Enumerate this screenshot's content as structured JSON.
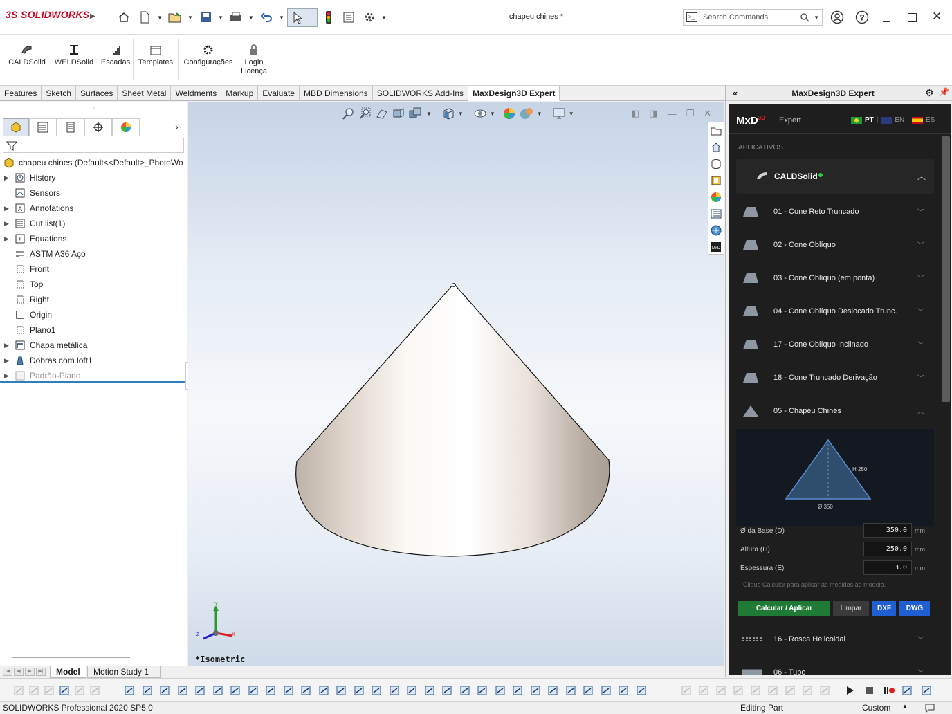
{
  "app": {
    "brand_prefix": "3S",
    "brand": "SOLIDWORKS",
    "document_title": "chapeu chines *"
  },
  "search": {
    "placeholder": "Search Commands"
  },
  "commands": [
    {
      "label": "CALDSolid"
    },
    {
      "label": "WELDSolid"
    },
    {
      "label": "Escadas"
    },
    {
      "label": "Templates"
    },
    {
      "label": "Configurações"
    },
    {
      "label": "Login\nLicença"
    }
  ],
  "tabs": [
    "Features",
    "Sketch",
    "Surfaces",
    "Sheet Metal",
    "Weldments",
    "Markup",
    "Evaluate",
    "MBD Dimensions",
    "SOLIDWORKS Add-Ins",
    "MaxDesign3D Expert"
  ],
  "active_tab": "MaxDesign3D Expert",
  "feature_tree": {
    "root": "chapeu chines  (Default<<Default>_PhotoWo",
    "items": [
      {
        "label": "History",
        "expandable": true
      },
      {
        "label": "Sensors",
        "expandable": false
      },
      {
        "label": "Annotations",
        "expandable": true
      },
      {
        "label": "Cut list(1)",
        "expandable": true
      },
      {
        "label": "Equations",
        "expandable": true
      },
      {
        "label": "ASTM A36 Aço",
        "expandable": false
      },
      {
        "label": "Front",
        "expandable": false
      },
      {
        "label": "Top",
        "expandable": false
      },
      {
        "label": "Right",
        "expandable": false
      },
      {
        "label": "Origin",
        "expandable": false
      },
      {
        "label": "Plano1",
        "expandable": false
      },
      {
        "label": "Chapa metálica",
        "expandable": true
      },
      {
        "label": "Dobras com loft1",
        "expandable": true
      },
      {
        "label": "Padrão-Plano",
        "expandable": true,
        "suppressed": true
      }
    ]
  },
  "viewport": {
    "view_label": "*Isometric",
    "axes": {
      "x": "X",
      "y": "Y",
      "z": "Z"
    }
  },
  "taskpane": {
    "title": "MaxDesign3D Expert",
    "brand": "MxD",
    "brand_sup": "3D",
    "edition": "Expert",
    "langs": [
      "PT",
      "EN",
      "ES"
    ],
    "section_label": "APLICATIVOS",
    "app_name": "CALDSolid",
    "items": [
      {
        "label": "01 - Cone Reto Truncado"
      },
      {
        "label": "02 - Cone Oblíquo"
      },
      {
        "label": "03 - Cone Oblíquo (em ponta)"
      },
      {
        "label": "04 - Cone Oblíquo Deslocado Trunc."
      },
      {
        "label": "17 - Cone Oblíquo Inclinado"
      },
      {
        "label": "18 - Cone Truncado Derivação"
      },
      {
        "label": "05 - Chapéu Chinês"
      }
    ],
    "diagram": {
      "height_label": "H 250",
      "diameter_label": "Ø 350"
    },
    "fields": [
      {
        "label": "Ø da Base (D)",
        "value": "350.0",
        "unit": "mm"
      },
      {
        "label": "Altura (H)",
        "value": "250.0",
        "unit": "mm"
      },
      {
        "label": "Espessura (E)",
        "value": "3.0",
        "unit": "mm"
      }
    ],
    "hint": "Clique Calcular para aplicar as medidas ao modelo.",
    "buttons": {
      "calc": "Calcular / Aplicar",
      "clear": "Limpar",
      "dxf": "DXF",
      "dwg": "DWG"
    },
    "more_items": [
      {
        "label": "16 - Rosca Helicoidal"
      },
      {
        "label": "06 - Tubo"
      }
    ],
    "colors": {
      "calc": "#1f7a36",
      "clear": "#3a3a3a",
      "export": "#1f5fd1",
      "status_dot": "#2ecc40",
      "diagram_fill": "#2f4e6e",
      "diagram_stroke": "#5a8fd6"
    }
  },
  "bottom_tabs": [
    "Model",
    "Motion Study 1"
  ],
  "status": {
    "left": "SOLIDWORKS Professional 2020 SP5.0",
    "mode": "Editing Part",
    "units": "Custom"
  }
}
